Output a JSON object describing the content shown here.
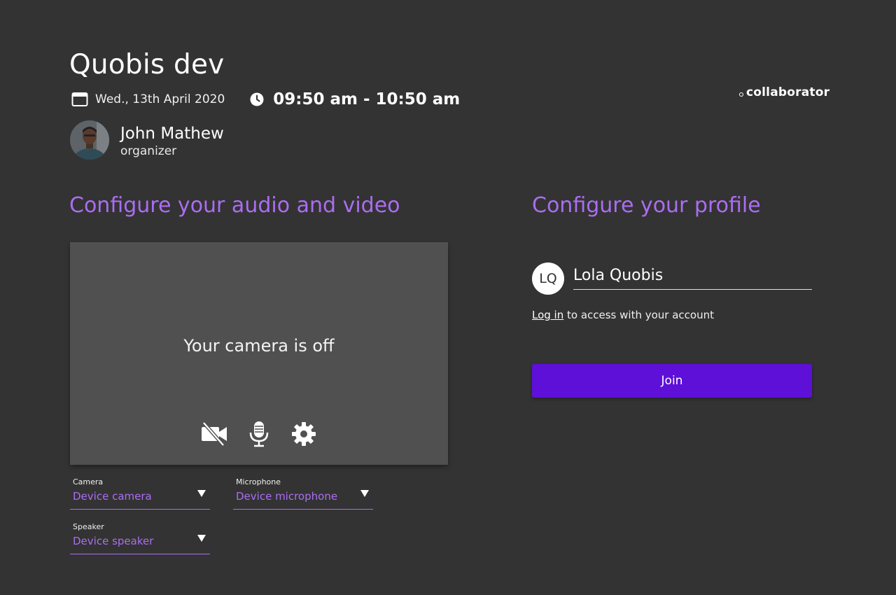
{
  "meeting": {
    "title": "Quobis dev",
    "date": "Wed., 13th April 2020",
    "time": "09:50 am - 10:50 am"
  },
  "organizer": {
    "name": "John Mathew",
    "role": "organizer"
  },
  "brand": {
    "name": "collaborator"
  },
  "audio_video": {
    "heading": "Configure your audio and video",
    "camera_off_text": "Your camera is off",
    "controls": {
      "camera_icon": "video-off-icon",
      "mic_icon": "microphone-icon",
      "settings_icon": "gear-icon"
    },
    "selects": {
      "camera": {
        "label": "Camera",
        "value": "Device camera"
      },
      "microphone": {
        "label": "Microphone",
        "value": "Device microphone"
      },
      "speaker": {
        "label": "Speaker",
        "value": "Device speaker"
      }
    }
  },
  "profile": {
    "heading": "Configure your profile",
    "initials": "LQ",
    "name_value": "Lola Quobis",
    "login_link": "Log in",
    "login_suffix": " to access with your account",
    "join_label": "Join"
  },
  "colors": {
    "background": "#333333",
    "accent": "#ab6df2",
    "join_button": "#5e10d9",
    "video_panel": "#505050"
  }
}
